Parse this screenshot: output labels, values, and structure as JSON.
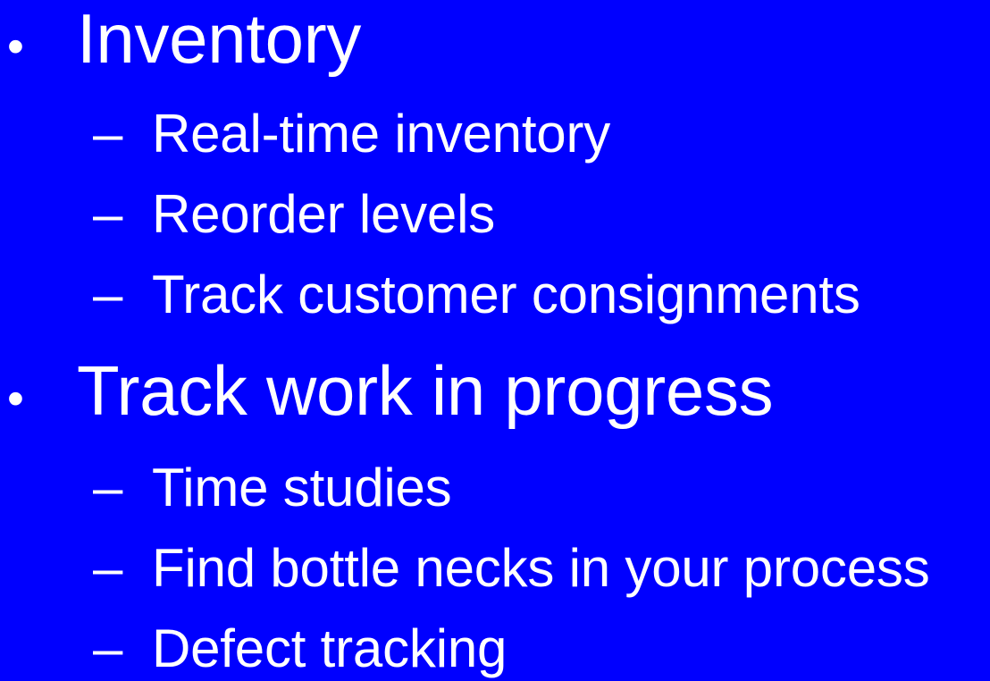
{
  "slide": {
    "background": "#0000ff",
    "text_color": "#ffffff",
    "bullet_marker": "•",
    "sub_marker": "–",
    "sections": [
      {
        "label": "Inventory",
        "items": [
          "Real-time inventory",
          "Reorder levels",
          "Track customer consignments"
        ]
      },
      {
        "label": "Track work in progress",
        "items": [
          "Time studies",
          "Find bottle necks in your process",
          "Defect tracking"
        ]
      }
    ]
  }
}
